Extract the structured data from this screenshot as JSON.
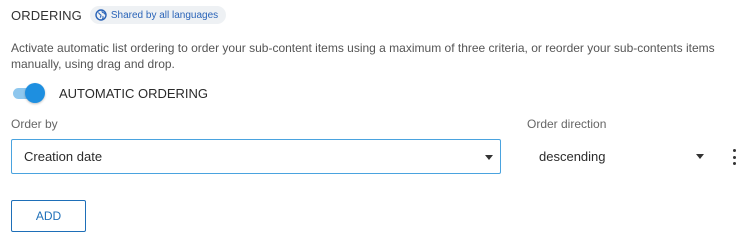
{
  "section": {
    "title": "ORDERING",
    "badge_label": "Shared by all languages",
    "badge_icon": "globe-icon"
  },
  "description": "Activate automatic list ordering to order your sub-content items using a maximum of three criteria, or reorder your sub-contents items manually, using drag and drop.",
  "toggle": {
    "label": "AUTOMATIC ORDERING",
    "on": true
  },
  "order_by": {
    "label": "Order by",
    "value": "Creation date"
  },
  "order_direction": {
    "label": "Order direction",
    "value": "descending"
  },
  "add_button_label": "ADD",
  "colors": {
    "accent": "#1e8fe0",
    "badge_text": "#2a64b8",
    "badge_bg": "#eef1f4",
    "focus_border": "#4aa3df",
    "button": "#1e6fb8"
  }
}
